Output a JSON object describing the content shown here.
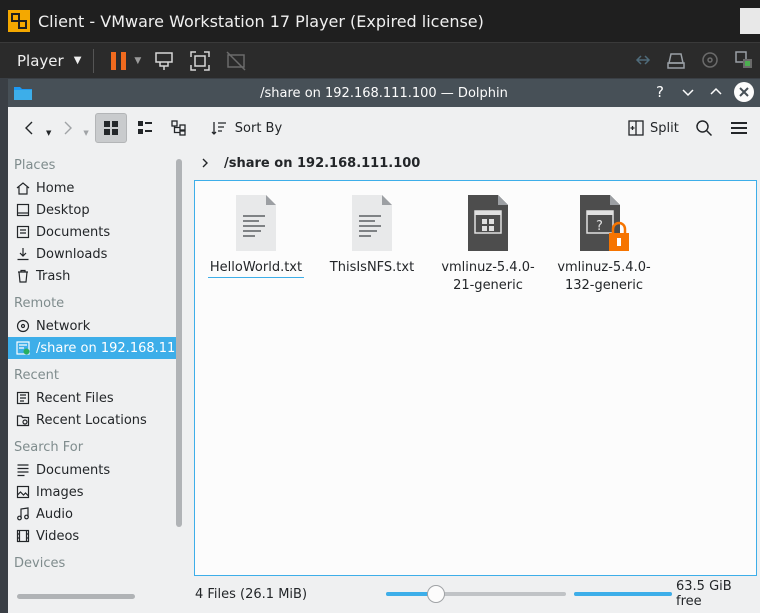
{
  "vmware": {
    "title": "Client - VMware Workstation 17 Player (Expired license)",
    "player_label": "Player"
  },
  "dolphin": {
    "window_title": "/share on 192.168.111.100 — Dolphin",
    "help_glyph": "?",
    "toolbar": {
      "sort_label": "Sort By",
      "split_label": "Split"
    },
    "breadcrumb": "/share on 192.168.111.100",
    "places": [
      {
        "type": "section",
        "label": "Places"
      },
      {
        "type": "item",
        "label": "Home",
        "icon": "home-icon"
      },
      {
        "type": "item",
        "label": "Desktop",
        "icon": "desktop-icon"
      },
      {
        "type": "item",
        "label": "Documents",
        "icon": "documents-icon"
      },
      {
        "type": "item",
        "label": "Downloads",
        "icon": "downloads-icon"
      },
      {
        "type": "item",
        "label": "Trash",
        "icon": "trash-icon"
      },
      {
        "type": "section",
        "label": "Remote"
      },
      {
        "type": "item",
        "label": "Network",
        "icon": "network-icon"
      },
      {
        "type": "item",
        "label": "/share on 192.168.111.100",
        "icon": "network-share-icon",
        "selected": true
      },
      {
        "type": "section",
        "label": "Recent"
      },
      {
        "type": "item",
        "label": "Recent Files",
        "icon": "recent-files-icon"
      },
      {
        "type": "item",
        "label": "Recent Locations",
        "icon": "recent-locations-icon"
      },
      {
        "type": "section",
        "label": "Search For"
      },
      {
        "type": "item",
        "label": "Documents",
        "icon": "search-documents-icon"
      },
      {
        "type": "item",
        "label": "Images",
        "icon": "images-icon"
      },
      {
        "type": "item",
        "label": "Audio",
        "icon": "audio-icon"
      },
      {
        "type": "item",
        "label": "Videos",
        "icon": "videos-icon"
      },
      {
        "type": "section",
        "label": "Devices"
      }
    ],
    "files": [
      {
        "name": "HelloWorld.txt",
        "kind": "text",
        "focused": true
      },
      {
        "name": "ThisIsNFS.txt",
        "kind": "text"
      },
      {
        "name": "vmlinuz-5.4.0-21-generic",
        "kind": "executable"
      },
      {
        "name": "vmlinuz-5.4.0-132-generic",
        "kind": "locked-unknown"
      }
    ],
    "status": {
      "summary": "4 Files (26.1 MiB)",
      "zoom_fraction": 0.28,
      "disk_used_fraction": 0.0,
      "free_space": "63.5 GiB free"
    },
    "colors": {
      "accent": "#3daee9",
      "titlebar": "#475057",
      "lock": "#f67400"
    }
  }
}
